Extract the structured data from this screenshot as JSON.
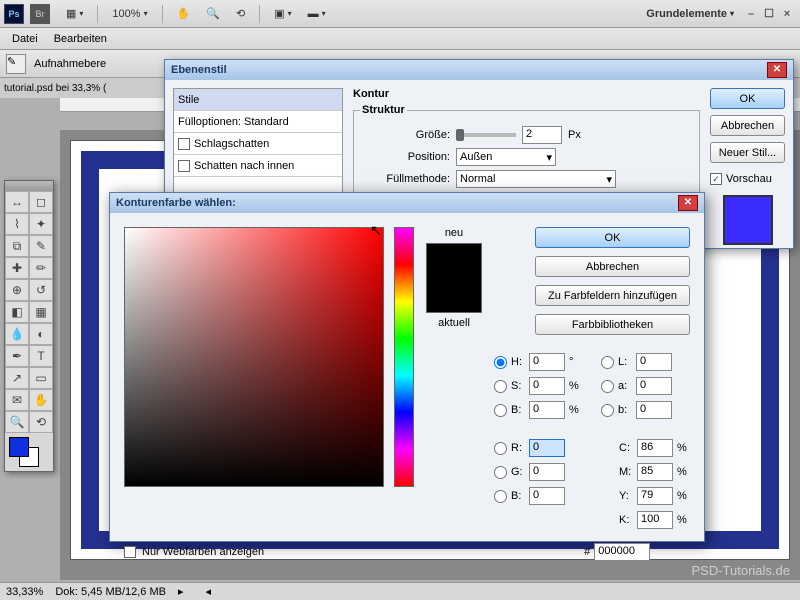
{
  "topbar": {
    "ps": "Ps",
    "br": "Br",
    "zoom": "100%",
    "workspace": "Grundelemente"
  },
  "menu": {
    "file": "Datei",
    "edit": "Bearbeiten"
  },
  "optbar": {
    "mode": "Aufnahmebere"
  },
  "doctab": "tutorial.psd bei 33,3% (",
  "layerstyle": {
    "title": "Ebenenstil",
    "styles": "Stile",
    "blend": "Fülloptionen: Standard",
    "dropshadow": "Schlagschatten",
    "innershadow": "Schatten nach innen",
    "section_title": "Kontur",
    "struct": "Struktur",
    "size_label": "Größe:",
    "size_val": "2",
    "size_unit": "Px",
    "pos_label": "Position:",
    "pos_val": "Außen",
    "blend_label": "Füllmethode:",
    "blend_val": "Normal",
    "ok": "OK",
    "cancel": "Abbrechen",
    "newstyle": "Neuer Stil...",
    "preview": "Vorschau"
  },
  "colorpicker": {
    "title": "Konturenfarbe wählen:",
    "new": "neu",
    "current": "aktuell",
    "ok": "OK",
    "cancel": "Abbrechen",
    "addto": "Zu Farbfeldern hinzufügen",
    "libs": "Farbbibliotheken",
    "H": "H:",
    "H_val": "0",
    "H_unit": "°",
    "S": "S:",
    "S_val": "0",
    "S_unit": "%",
    "B": "B:",
    "B_val": "0",
    "B_unit": "%",
    "R": "R:",
    "R_val": "0",
    "G": "G:",
    "G_val": "0",
    "B2": "B:",
    "B2_val": "0",
    "L": "L:",
    "L_val": "0",
    "a": "a:",
    "a_val": "0",
    "b": "b:",
    "b_val": "0",
    "C": "C:",
    "C_val": "86",
    "C_unit": "%",
    "M": "M:",
    "M_val": "85",
    "M_unit": "%",
    "Y": "Y:",
    "Y_val": "79",
    "Y_unit": "%",
    "K": "K:",
    "K_val": "100",
    "K_unit": "%",
    "hex_label": "#",
    "hex": "000000",
    "webonly": "Nur Webfarben anzeigen"
  },
  "status": {
    "zoom": "33,33%",
    "doc": "Dok: 5,45 MB/12,6 MB"
  },
  "watermark": "PSD-Tutorials.de"
}
